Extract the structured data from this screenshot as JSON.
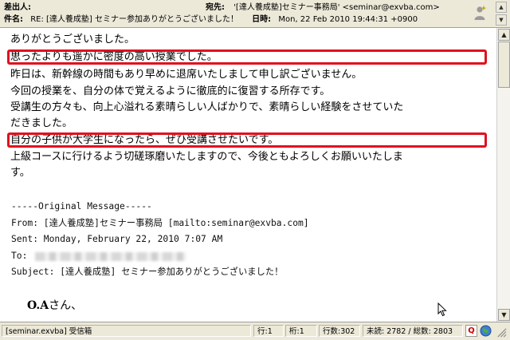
{
  "header": {
    "from_label": "差出人:",
    "from_value": "",
    "to_label": "宛先:",
    "to_value": "'[達人養成塾]セミナー事務局' <seminar@exvba.com>",
    "subject_label": "件名:",
    "subject_value": "RE: [達人養成塾] セミナー参加ありがとうございました！",
    "date_label": "日時:",
    "date_value": "Mon, 22 Feb 2010 19:44:31 +0900"
  },
  "body": {
    "lines": [
      "ありがとうございました。",
      "思ったよりも遥かに密度の高い授業でした。",
      "昨日は、新幹線の時間もあり早めに退席いたしまして申し訳ございません。",
      "今回の授業を、自分の体で覚えるように徹底的に復習する所存です。",
      "受講生の方々も、向上心溢れる素晴らしい人ばかりで、素晴らしい経験をさせていた",
      "だきました。",
      "自分の子供が大学生になったら、ぜひ受講させたいです。",
      "上級コースに行けるよう切磋琢磨いたしますので、今後ともよろしくお願いいたしま",
      "す。"
    ],
    "original_message": "-----Original Message-----",
    "orig_from": "From: [達人養成塾]セミナー事務局 [mailto:seminar@exvba.com]",
    "orig_sent": "Sent: Monday, February 22, 2010 7:07 AM",
    "orig_to_label": "To:",
    "orig_subject": "Subject: [達人養成塾] セミナー参加ありがとうございました！",
    "greeting_name": "O.A",
    "greeting_suffix": "さん、"
  },
  "highlight_color": "#e0101e",
  "status": {
    "folder": "[seminar.exvba] 受信箱",
    "line": "行:1",
    "column": "桁:1",
    "row_count": "行数:302",
    "counts": "未読: 2782 / 総数: 2803",
    "q_icon": "Q"
  }
}
